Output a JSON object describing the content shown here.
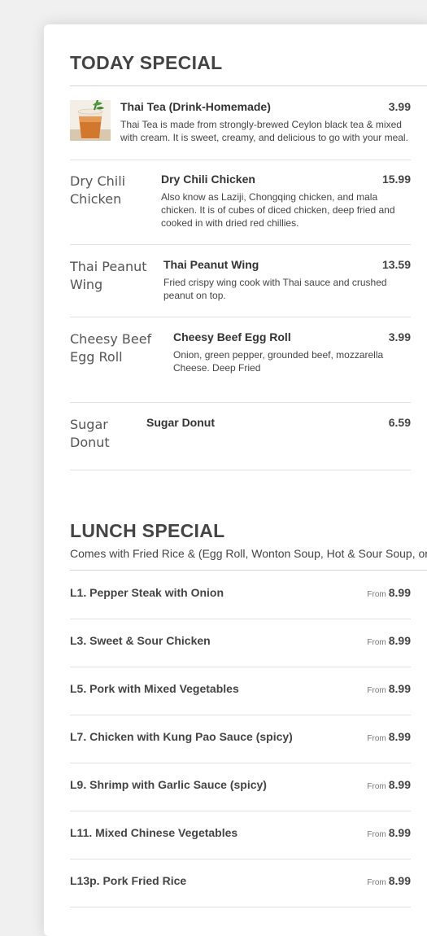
{
  "today_special": {
    "title": "TODAY SPECIAL",
    "items": [
      {
        "name": "Thai Tea (Drink-Homemade)",
        "price": "3.99",
        "description": "Thai Tea is made from strongly-brewed Ceylon black tea & mixed with cream. It is sweet, creamy, and delicious to go with your meal.",
        "image_alt": ""
      },
      {
        "name": "Dry Chili Chicken",
        "price": "15.99",
        "description": "Also know as Laziji, Chongqing chicken, and mala chicken. It is of cubes of diced chicken, deep fried and cooked in with dried red chillies.",
        "image_alt": "Dry Chili Chicken"
      },
      {
        "name": "Thai Peanut Wing",
        "price": "13.59",
        "description": "Fried crispy wing cook with Thai sauce and crushed peanut on top.",
        "image_alt": "Thai Peanut Wing"
      },
      {
        "name": "Cheesy Beef Egg Roll",
        "price": "3.99",
        "description": "Onion, green pepper, grounded beef, mozzarella Cheese. Deep Fried",
        "image_alt": "Cheesy Beef Egg Roll"
      },
      {
        "name": "Sugar Donut",
        "price": "6.59",
        "description": "",
        "image_alt": "Sugar Donut"
      }
    ]
  },
  "lunch_special": {
    "title": "LUNCH SPECIAL",
    "subtitle": "Comes with Fried Rice & (Egg Roll, Wonton Soup, Hot & Sour Soup, or",
    "price_prefix": "From",
    "items": [
      {
        "name": "L1. Pepper Steak with Onion",
        "price": "8.99"
      },
      {
        "name": "L3. Sweet & Sour Chicken",
        "price": "8.99"
      },
      {
        "name": "L5. Pork with Mixed Vegetables",
        "price": "8.99"
      },
      {
        "name": "L7. Chicken with Kung Pao Sauce (spicy)",
        "price": "8.99"
      },
      {
        "name": "L9. Shrimp with Garlic Sauce (spicy)",
        "price": "8.99"
      },
      {
        "name": "L11. Mixed Chinese Vegetables",
        "price": "8.99"
      },
      {
        "name": "L13p. Pork Fried Rice",
        "price": "8.99"
      }
    ]
  }
}
